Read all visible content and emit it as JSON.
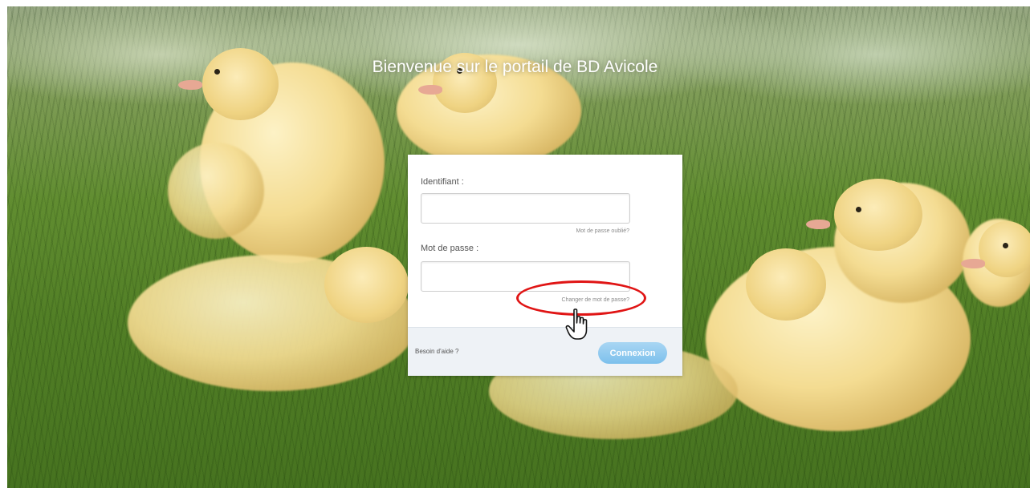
{
  "header": {
    "welcome_text": "Bienvenue sur le portail de BD Avicole"
  },
  "login": {
    "username_label": "Identifiant :",
    "username_value": "",
    "forgot_password_link": "Mot de passe oublié?",
    "password_label": "Mot de passe :",
    "password_value": "",
    "change_password_link": "Changer de mot de passe?",
    "help_link": "Besoin d'aide ?",
    "connect_button": "Connexion"
  },
  "icons": {
    "cursor": "hand-pointer-icon",
    "annotation": "red-ellipse-highlight"
  },
  "colors": {
    "button": "#7cc0ec",
    "highlight": "#e01515",
    "footer": "#eef2f6"
  }
}
